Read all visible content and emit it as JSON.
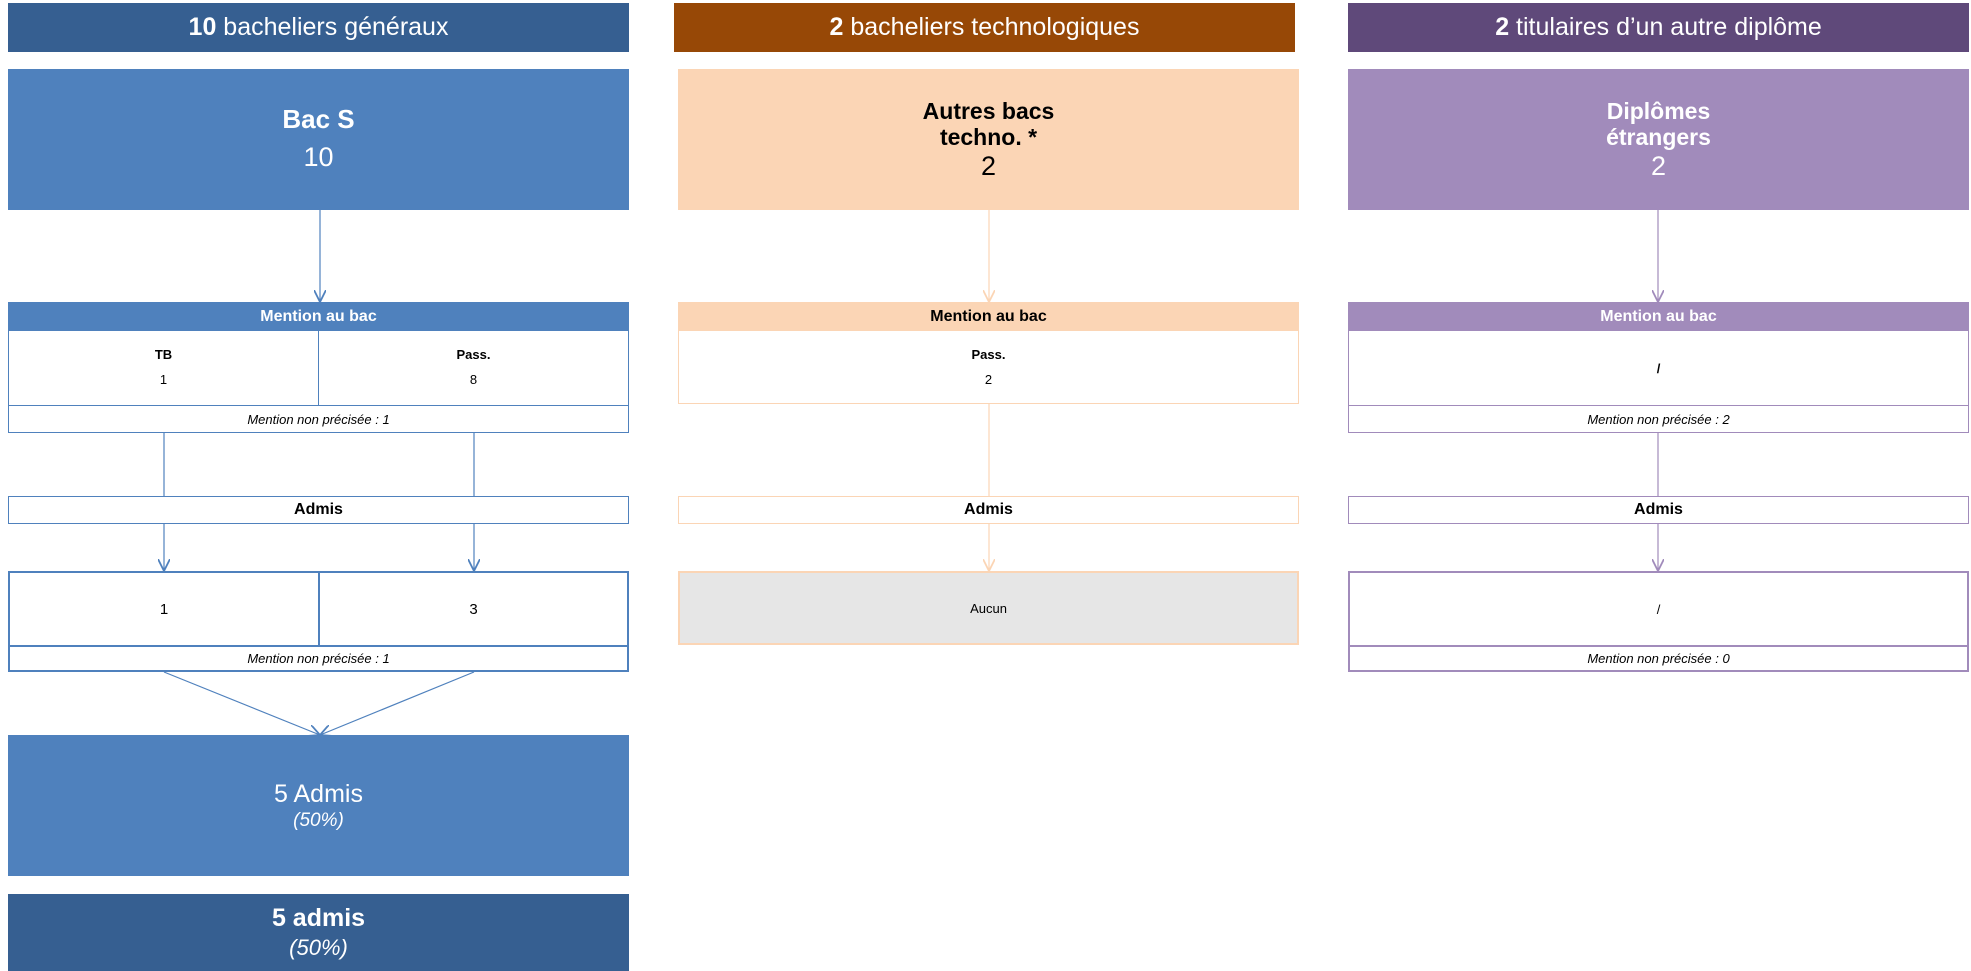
{
  "colors": {
    "blue": "#4f81bd",
    "blue_dark": "#365f91",
    "orange": "#974806",
    "peach": "#fbd5b5",
    "purple_dark": "#5f497a",
    "purple": "#a18bbb",
    "grey": "#e6e6e6"
  },
  "col1": {
    "header_num": "10",
    "header_text": " bacheliers généraux",
    "box_title": "Bac S",
    "box_value": "10",
    "mention_head": "Mention au bac",
    "m_tb_label": "TB",
    "m_tb_val": "1",
    "m_pass_label": "Pass.",
    "m_pass_val": "8",
    "m_nonprec": "Mention non précisée : 1",
    "admis_label": "Admis",
    "a_left": "1",
    "a_right": "3",
    "a_nonprec": "Mention non précisée : 1",
    "result_main": "5 Admis",
    "result_pct": "(50%)",
    "footer_main": "5 admis",
    "footer_pct": "(50%)"
  },
  "col2": {
    "header_num": "2",
    "header_text": " bacheliers technologiques",
    "box_title_l1": "Autres bacs",
    "box_title_l2": "techno. *",
    "box_value": "2",
    "mention_head": "Mention au bac",
    "m_pass_label": "Pass.",
    "m_pass_val": "2",
    "admis_label": "Admis",
    "result": "Aucun"
  },
  "col3": {
    "header_num": "2",
    "header_text": " titulaires d’un autre diplôme",
    "box_title_l1": "Diplômes",
    "box_title_l2": "étrangers",
    "box_value": "2",
    "mention_head": "Mention au bac",
    "m_slash": "/",
    "m_nonprec": "Mention non précisée : 2",
    "admis_label": "Admis",
    "a_slash": "/",
    "a_nonprec": "Mention non précisée : 0"
  }
}
